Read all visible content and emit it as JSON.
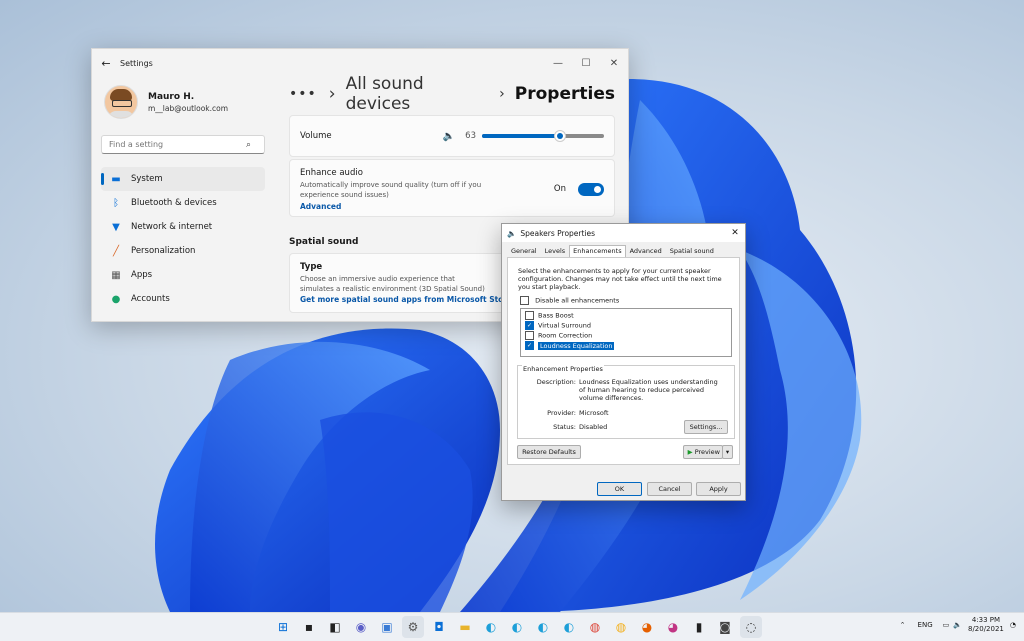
{
  "settings": {
    "title": "Settings",
    "user": {
      "name": "Mauro H.",
      "email": "m__lab@outlook.com"
    },
    "search_placeholder": "Find a setting",
    "nav": [
      {
        "label": "System",
        "icon": "monitor-icon",
        "selected": true
      },
      {
        "label": "Bluetooth & devices",
        "icon": "bluetooth-icon"
      },
      {
        "label": "Network & internet",
        "icon": "wifi-icon"
      },
      {
        "label": "Personalization",
        "icon": "brush-icon"
      },
      {
        "label": "Apps",
        "icon": "apps-icon"
      },
      {
        "label": "Accounts",
        "icon": "person-icon"
      }
    ],
    "breadcrumb": {
      "dots": "•••",
      "parent": "All sound devices",
      "current": "Properties"
    },
    "volume": {
      "label": "Volume",
      "value": "63",
      "level": 0.63
    },
    "enhance": {
      "title": "Enhance audio",
      "desc": "Automatically improve sound quality (turn off if you experience sound issues)",
      "link": "Advanced",
      "state": "On"
    },
    "spatial": {
      "heading": "Spatial sound",
      "type_title": "Type",
      "type_desc": "Choose an immersive audio experience that simulates a realistic environment (3D Spatial Sound)",
      "link": "Get more spatial sound apps from Microsoft Store"
    }
  },
  "dialog": {
    "title": "Speakers Properties",
    "tabs": [
      "General",
      "Levels",
      "Enhancements",
      "Advanced",
      "Spatial sound"
    ],
    "active_tab": "Enhancements",
    "intro": "Select the enhancements to apply for your current speaker configuration. Changes may not take effect until the next time you start playback.",
    "disable_all": "Disable all enhancements",
    "enhancements": [
      {
        "label": "Bass Boost",
        "checked": false
      },
      {
        "label": "Virtual Surround",
        "checked": true
      },
      {
        "label": "Room Correction",
        "checked": false
      },
      {
        "label": "Loudness Equalization",
        "checked": true,
        "highlighted": true
      }
    ],
    "props_legend": "Enhancement Properties",
    "description_label": "Description:",
    "description": "Loudness Equalization uses understanding of human hearing to reduce perceived volume differences.",
    "provider_label": "Provider:",
    "provider": "Microsoft",
    "status_label": "Status:",
    "status": "Disabled",
    "settings_btn": "Settings...",
    "restore_btn": "Restore Defaults",
    "preview_btn": "Preview",
    "ok": "OK",
    "cancel": "Cancel",
    "apply": "Apply"
  },
  "taskbar": {
    "lang": "ENG",
    "time": "4:33 PM",
    "date": "8/20/2021"
  }
}
